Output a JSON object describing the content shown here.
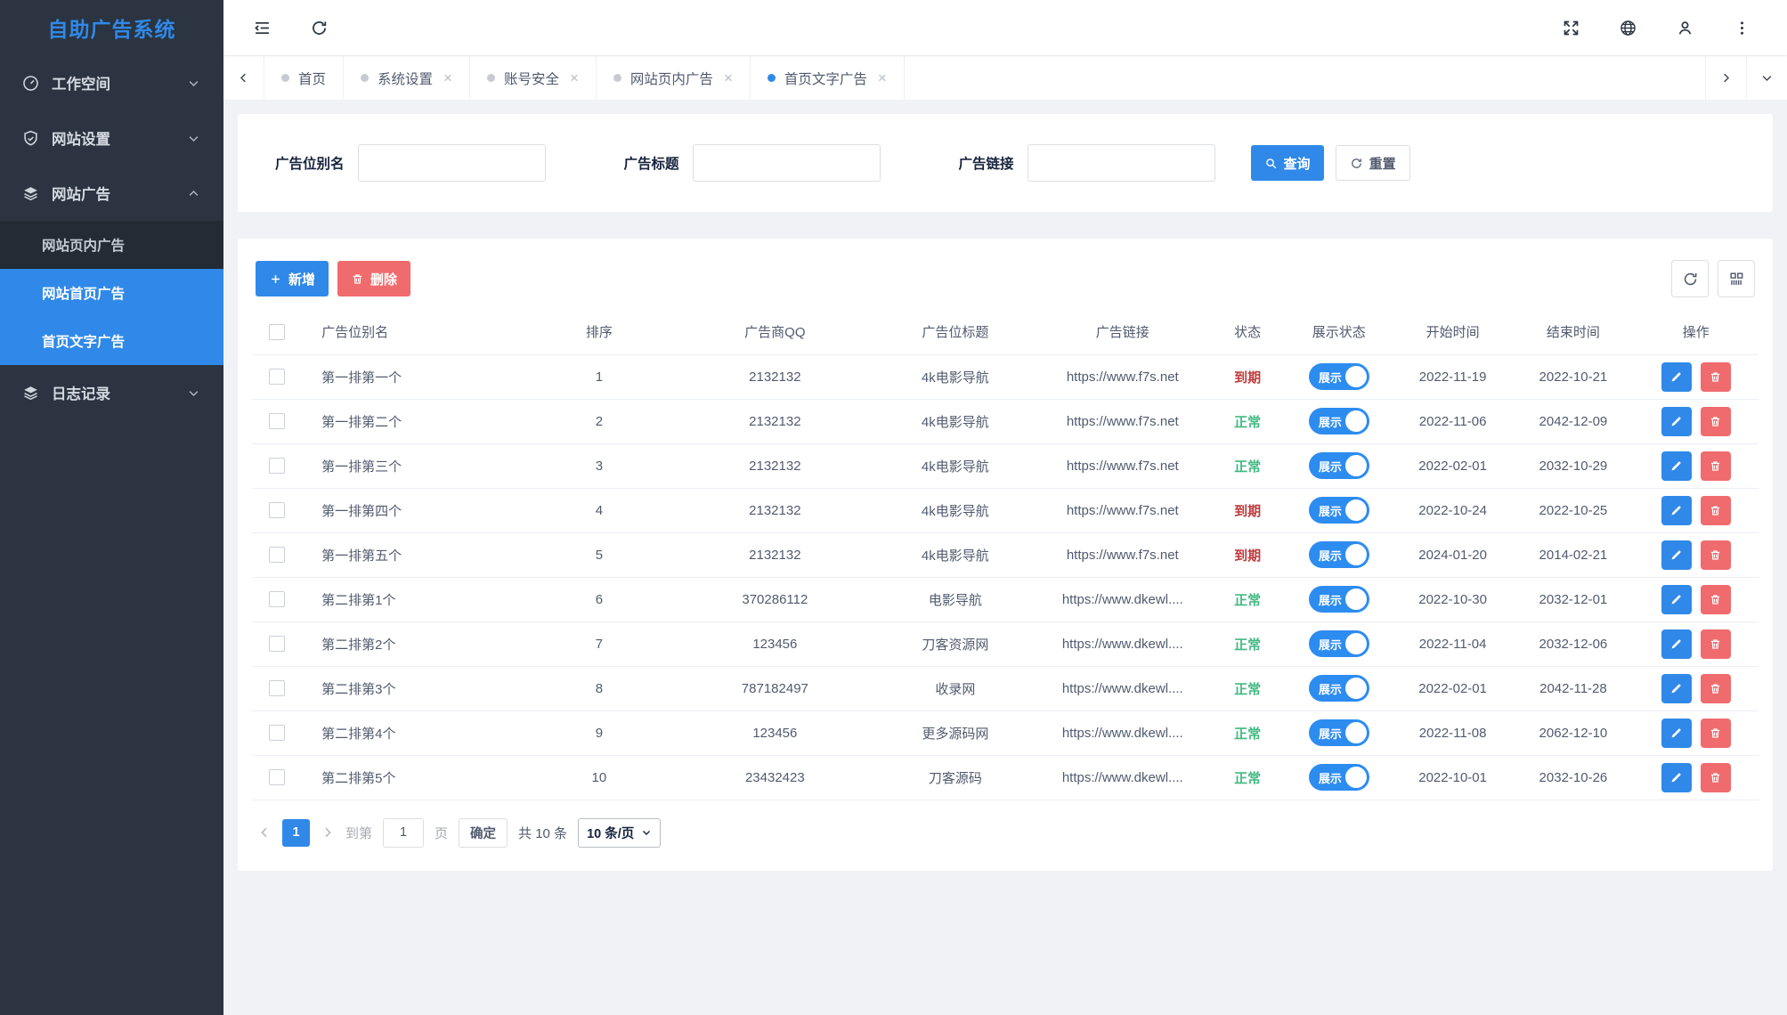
{
  "colors": {
    "accent": "#3089e8",
    "toggle_blue": "#2d8cf0",
    "danger": "#f06b6d",
    "status_expired": "#c0393b",
    "status_normal": "#42b983",
    "sidebar_bg": "#2b3440",
    "submenu_bg": "#232b35"
  },
  "sidebar": {
    "title": "自助广告系统",
    "items": [
      {
        "label": "工作空间",
        "icon": "dashboard-icon",
        "chevron": "down"
      },
      {
        "label": "网站设置",
        "icon": "shield-check-icon",
        "chevron": "down"
      },
      {
        "label": "网站广告",
        "icon": "layers-icon",
        "chevron": "up",
        "children": [
          {
            "label": "网站页内广告",
            "active": false
          },
          {
            "label": "网站首页广告",
            "active": true
          },
          {
            "label": "首页文字广告",
            "active": true
          }
        ]
      },
      {
        "label": "日志记录",
        "icon": "layers-icon",
        "chevron": "down"
      }
    ]
  },
  "topbar": {
    "left_icons": [
      "collapse-menu-icon",
      "refresh-icon"
    ],
    "right_icons": [
      "fullscreen-icon",
      "globe-icon",
      "user-icon",
      "kebab-menu-icon"
    ]
  },
  "tabs": [
    {
      "label": "首页",
      "closable": false,
      "active": false
    },
    {
      "label": "系统设置",
      "closable": true,
      "active": false
    },
    {
      "label": "账号安全",
      "closable": true,
      "active": false
    },
    {
      "label": "网站页内广告",
      "closable": true,
      "active": false
    },
    {
      "label": "首页文字广告",
      "closable": true,
      "active": true
    }
  ],
  "search": {
    "fields": [
      {
        "label": "广告位别名",
        "value": ""
      },
      {
        "label": "广告标题",
        "value": ""
      },
      {
        "label": "广告链接",
        "value": ""
      }
    ],
    "query_label": "查询",
    "reset_label": "重置"
  },
  "toolbar": {
    "add_label": "新增",
    "delete_label": "删除"
  },
  "table": {
    "columns": [
      "广告位别名",
      "排序",
      "广告商QQ",
      "广告位标题",
      "广告链接",
      "状态",
      "展示状态",
      "开始时间",
      "结束时间",
      "操作"
    ],
    "toggle_label": "展示",
    "rows": [
      {
        "alias": "第一排第一个",
        "order": "1",
        "qq": "2132132",
        "title": "4k电影导航",
        "link": "https://www.f7s.net",
        "status": "到期",
        "status_type": "expired",
        "start": "2022-11-19",
        "end": "2022-10-21"
      },
      {
        "alias": "第一排第二个",
        "order": "2",
        "qq": "2132132",
        "title": "4k电影导航",
        "link": "https://www.f7s.net",
        "status": "正常",
        "status_type": "normal",
        "start": "2022-11-06",
        "end": "2042-12-09"
      },
      {
        "alias": "第一排第三个",
        "order": "3",
        "qq": "2132132",
        "title": "4k电影导航",
        "link": "https://www.f7s.net",
        "status": "正常",
        "status_type": "normal",
        "start": "2022-02-01",
        "end": "2032-10-29"
      },
      {
        "alias": "第一排第四个",
        "order": "4",
        "qq": "2132132",
        "title": "4k电影导航",
        "link": "https://www.f7s.net",
        "status": "到期",
        "status_type": "expired",
        "start": "2022-10-24",
        "end": "2022-10-25"
      },
      {
        "alias": "第一排第五个",
        "order": "5",
        "qq": "2132132",
        "title": "4k电影导航",
        "link": "https://www.f7s.net",
        "status": "到期",
        "status_type": "expired",
        "start": "2024-01-20",
        "end": "2014-02-21"
      },
      {
        "alias": "第二排第1个",
        "order": "6",
        "qq": "370286112",
        "title": "电影导航",
        "link": "https://www.dkewl....",
        "status": "正常",
        "status_type": "normal",
        "start": "2022-10-30",
        "end": "2032-12-01"
      },
      {
        "alias": "第二排第2个",
        "order": "7",
        "qq": "123456",
        "title": "刀客资源网",
        "link": "https://www.dkewl....",
        "status": "正常",
        "status_type": "normal",
        "start": "2022-11-04",
        "end": "2032-12-06"
      },
      {
        "alias": "第二排第3个",
        "order": "8",
        "qq": "787182497",
        "title": "收录网",
        "link": "https://www.dkewl....",
        "status": "正常",
        "status_type": "normal",
        "start": "2022-02-01",
        "end": "2042-11-28"
      },
      {
        "alias": "第二排第4个",
        "order": "9",
        "qq": "123456",
        "title": "更多源码网",
        "link": "https://www.dkewl....",
        "status": "正常",
        "status_type": "normal",
        "start": "2022-11-08",
        "end": "2062-12-10"
      },
      {
        "alias": "第二排第5个",
        "order": "10",
        "qq": "23432423",
        "title": "刀客源码",
        "link": "https://www.dkewl....",
        "status": "正常",
        "status_type": "normal",
        "start": "2022-10-01",
        "end": "2032-10-26"
      }
    ]
  },
  "pagination": {
    "page": "1",
    "goto_prefix": "到第",
    "goto_value": "1",
    "goto_suffix": "页",
    "confirm_label": "确定",
    "total_label": "共 10 条",
    "page_size_label": "10 条/页"
  }
}
